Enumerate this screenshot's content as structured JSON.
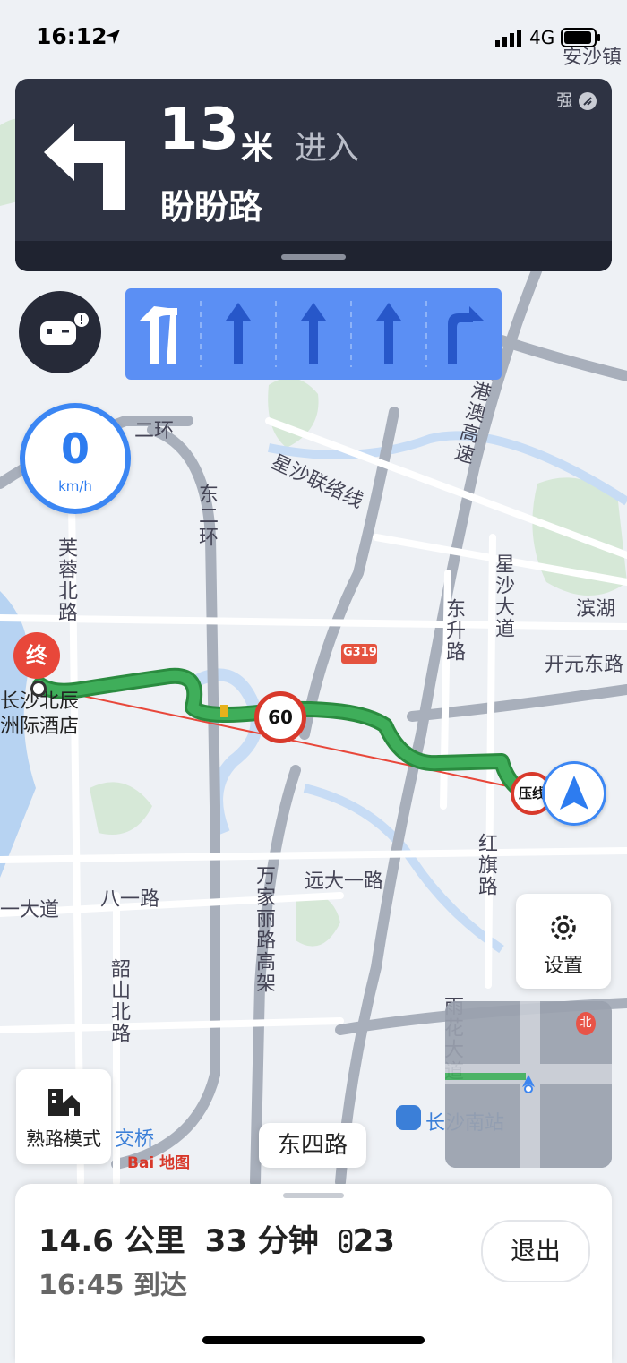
{
  "status_bar": {
    "time": "16:12",
    "network": "4G"
  },
  "navigation": {
    "distance_value": "13",
    "distance_unit": "米",
    "action": "进入",
    "road": "盼盼路",
    "signal_label": "强",
    "turn_icon": "turn-left-arrow-icon"
  },
  "lanes": [
    {
      "direction": "left-turn",
      "highlighted": true
    },
    {
      "direction": "straight",
      "highlighted": false
    },
    {
      "direction": "straight",
      "highlighted": false
    },
    {
      "direction": "straight",
      "highlighted": false
    },
    {
      "direction": "right-turn",
      "highlighted": false
    }
  ],
  "speedometer": {
    "value": "0",
    "unit": "km/h"
  },
  "speed_limit": "60",
  "lane_warning_label": "压线",
  "destination_marker": "终",
  "map_labels": {
    "top_town": "安沙镇",
    "ring_road_h": "二环",
    "ring_road_v": "东二环",
    "xingsha_line": "星沙联络线",
    "jingganghao": "京港澳高速",
    "xingsha_blvd": "星沙大道",
    "binhu": "滨湖",
    "kaiyuan": "开元东路",
    "dongsheng": "东升路",
    "g319": "G319",
    "furong": "芙蓉北路",
    "hotel": "长沙北辰洲际酒店",
    "hongqi": "红旗路",
    "yuanda": "远大一路",
    "wanjiali": "万家丽路高架",
    "bayi": "八一路",
    "dadao": "一大道",
    "shaoshan": "韶山北路",
    "yuhua": "雨花大道",
    "south_station": "长沙南站",
    "jiaoqiao": "交桥",
    "baidu": "Bai 地图",
    "north": "北"
  },
  "settings_button": "设置",
  "familiar_mode_button": "熟路模式",
  "current_road": "东四路",
  "trip": {
    "distance": "14.6 公里",
    "duration": "33 分钟",
    "traffic_lights": "23",
    "arrival": "16:45 到达"
  },
  "exit_button": "退出",
  "colors": {
    "nav_bg": "#2e3343",
    "lane_bg": "#5b8ff4",
    "route": "#3fae5a",
    "accent": "#2d7cf0",
    "destination": "#e8473a"
  }
}
